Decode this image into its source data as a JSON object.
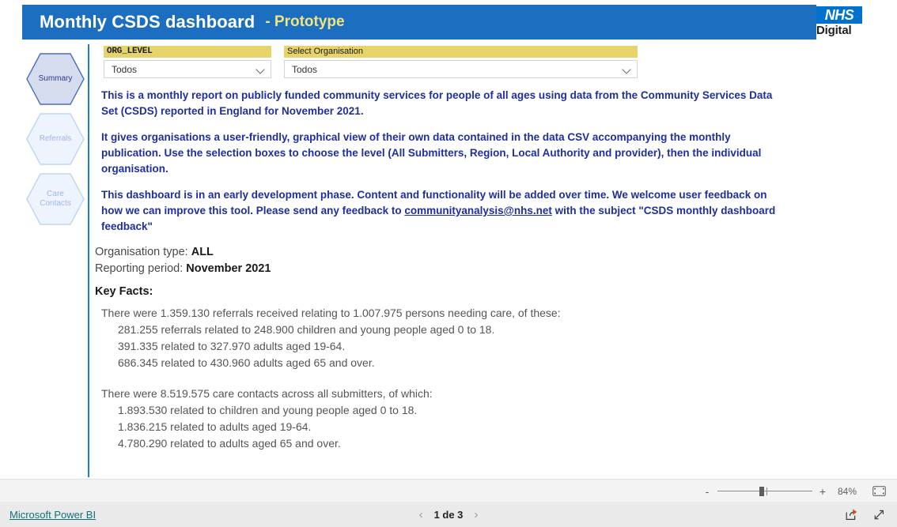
{
  "header": {
    "title": "Monthly CSDS dashboard",
    "subtitle": "- Prototype",
    "logo_mark": "NHS",
    "logo_word": "Digital",
    "banner_color": "#1c6fc0",
    "subtitle_color": "#f2e47a"
  },
  "sidebar": {
    "items": [
      {
        "label": "Summary",
        "active": true
      },
      {
        "label": "Referrals",
        "active": false
      },
      {
        "label": "Care\nContacts",
        "active": false
      }
    ]
  },
  "slicers": [
    {
      "header": "ORG_LEVEL",
      "value": "Todos"
    },
    {
      "header": "Select Organisation",
      "value": "Todos"
    }
  ],
  "intro": {
    "p1": "This is a monthly report on publicly funded community services for people of all ages using data from the Community Services Data Set (CSDS) reported in England for November 2021.",
    "p2": "It gives organisations a user-friendly, graphical view of their own data contained in the data CSV accompanying the monthly publication. Use the selection boxes to choose the level (All Submitters, Region, Local Authority and provider), then the individual organisation.",
    "p3_before": "This dashboard is in an early development phase. Content and functionality will be added over time. We welcome user feedback on how we can improve this tool. Please send any feedback to ",
    "p3_email": "communityanalysis@nhs.net",
    "p3_after": " with the subject \"CSDS monthly dashboard feedback\"",
    "text_color": "#1f2f9e"
  },
  "meta": {
    "org_type_label": "Organisation type:",
    "org_type_value": "ALL",
    "period_label": "Reporting period:",
    "period_value": "November 2021"
  },
  "key_facts": {
    "title": "Key Facts:",
    "referrals_lead": "There were 1.359.130 referrals received relating to 1.007.975 persons needing care, of these:",
    "referrals_items": [
      "281.255 referrals related to 248.900 children and young people aged 0 to 18.",
      "391.335 related to 327.970 adults aged 19-64.",
      "686.345 related to 430.960 adults aged 65 and over."
    ],
    "contacts_lead": "There were 8.519.575 care contacts across all submitters, of which:",
    "contacts_items": [
      "1.893.530 related to children and young people aged 0 to 18.",
      "1.836.215 related to adults aged 19-64.",
      "4.780.290 related to adults aged 65 and over."
    ]
  },
  "statusbar": {
    "zoom_out": "-",
    "zoom_in": "+",
    "zoom_percent": "84%",
    "fit_icon": "fit-to-page-icon"
  },
  "footer": {
    "brand_link": "Microsoft Power BI",
    "prev_arrow": "‹",
    "next_arrow": "›",
    "page_label": "1 de 3",
    "share_icon": "share-export-icon",
    "fullscreen_icon": "focus-mode-icon",
    "link_color": "#11717a"
  }
}
